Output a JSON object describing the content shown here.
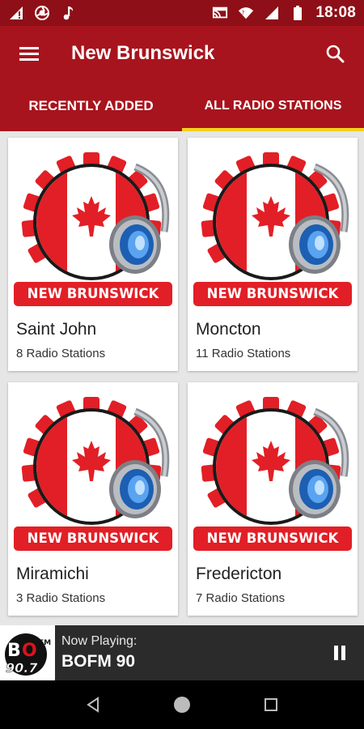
{
  "status_bar": {
    "time": "18:08",
    "left_icons": [
      "signal-alert-icon",
      "aperture-icon",
      "music-note-icon"
    ],
    "right_icons": [
      "cast-icon",
      "wifi-icon",
      "cellular-icon",
      "battery-icon"
    ]
  },
  "app_bar": {
    "title": "New Brunswick",
    "menu_icon": "hamburger-menu-icon",
    "search_icon": "search-icon",
    "background": "#a8141d",
    "status_background": "#8e0f17"
  },
  "tabs": [
    {
      "label": "RECENTLY ADDED",
      "active": false
    },
    {
      "label": "ALL RADIO STATIONS",
      "active": true
    }
  ],
  "tab_indicator_color": "#f4cf1f",
  "logo_banner_text": "NEW BRUNSWICK",
  "cities": [
    {
      "name": "Saint John",
      "stations": "8 Radio Stations"
    },
    {
      "name": "Moncton",
      "stations": "11 Radio Stations"
    },
    {
      "name": "Miramichi",
      "stations": "3 Radio Stations"
    },
    {
      "name": "Fredericton",
      "stations": "7 Radio Stations"
    }
  ],
  "now_playing": {
    "label": "Now Playing:",
    "station": "BOFM 90",
    "logo_text": "BO 90.7",
    "logo_fm": "FM",
    "pause_icon": "pause-icon"
  },
  "nav": {
    "icons": [
      "back-icon",
      "home-icon",
      "recents-icon"
    ]
  }
}
